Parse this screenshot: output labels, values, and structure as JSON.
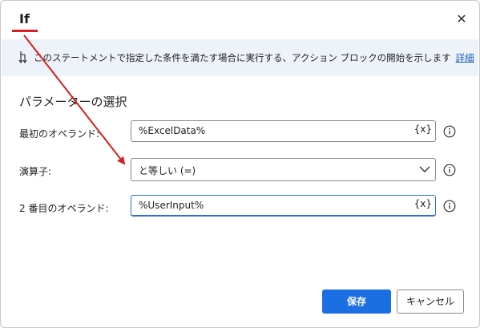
{
  "dialog": {
    "title": "If",
    "close_glyph": "✕"
  },
  "info": {
    "text": "このステートメントで指定した条件を満たす場合に実行する、アクション ブロックの開始を示します",
    "link": "詳細"
  },
  "section": {
    "title": "パラメーターの選択"
  },
  "fields": [
    {
      "label": "最初のオペランド:",
      "value": "%ExcelData%",
      "var_button": "{x}"
    },
    {
      "label": "演算子:",
      "value": "と等しい (=)"
    },
    {
      "label": "2 番目のオペランド:",
      "value": "%UserInput%",
      "var_button": "{x}"
    }
  ],
  "buttons": {
    "save": "保存",
    "cancel": "キャンセル"
  },
  "colors": {
    "primary": "#1c6fe3",
    "annotation": "#d32020",
    "info_band": "#eef3f9",
    "link": "#1b5fbf"
  },
  "icons": {
    "info": "flow-down-icon",
    "close": "close-icon",
    "help": "info-circle-icon",
    "dropdown": "chevron-down-icon"
  }
}
